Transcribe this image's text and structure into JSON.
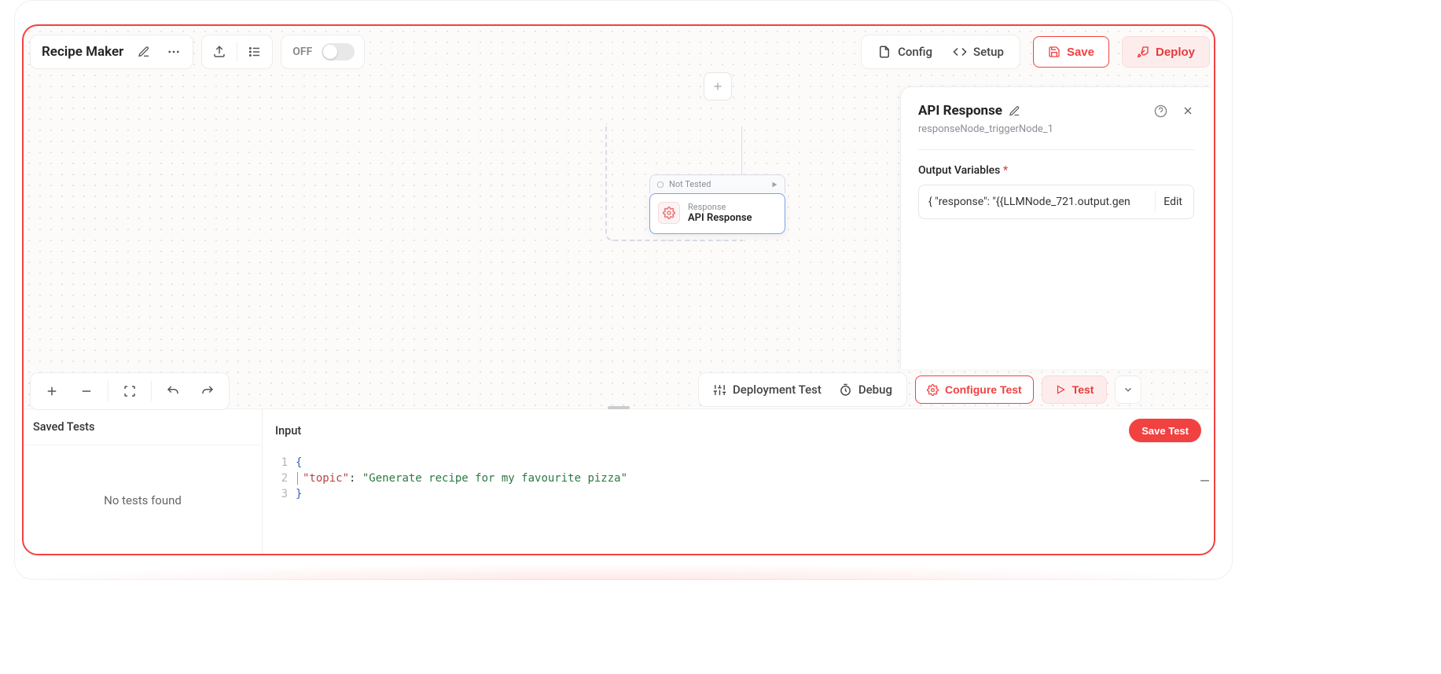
{
  "workflow": {
    "title": "Recipe Maker",
    "toggle_label": "OFF"
  },
  "top_right": {
    "config": "Config",
    "setup": "Setup",
    "save": "Save",
    "deploy": "Deploy"
  },
  "node": {
    "status": "Not Tested",
    "kind": "Response",
    "title": "API Response"
  },
  "panel": {
    "title": "API Response",
    "subtitle": "responseNode_triggerNode_1",
    "output_label": "Output Variables",
    "output_value": "{ \"response\": \"{{LLMNode_721.output.gen",
    "edit": "Edit"
  },
  "test_toolbar": {
    "deployment_test": "Deployment Test",
    "debug": "Debug",
    "configure_test": "Configure Test",
    "test": "Test"
  },
  "lower": {
    "saved_tests": "Saved Tests",
    "no_tests": "No tests found",
    "input": "Input",
    "save_test": "Save Test",
    "code": {
      "lines": [
        "1",
        "2",
        "3"
      ],
      "l1": "{",
      "l2_key": "\"topic\"",
      "l2_colon": ": ",
      "l2_val": "\"Generate recipe for my favourite pizza\"",
      "l3": "}"
    }
  }
}
